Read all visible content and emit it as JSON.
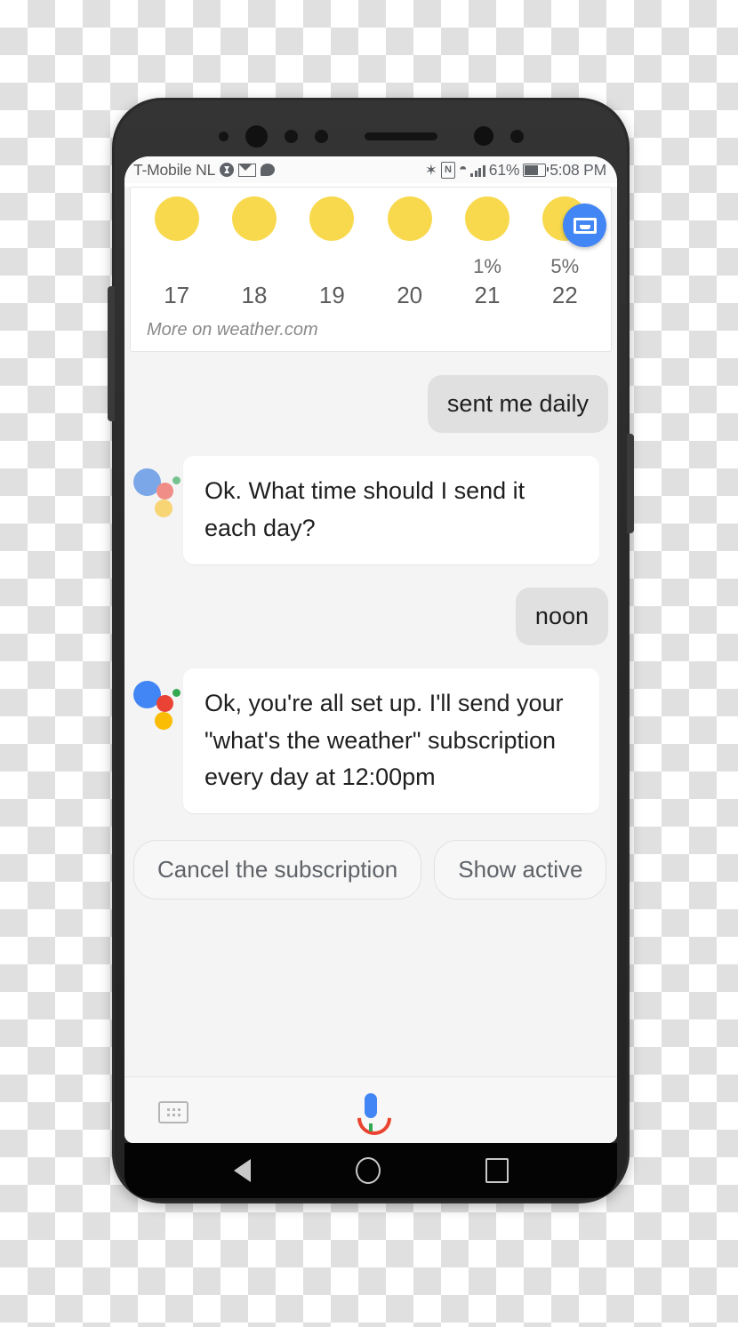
{
  "statusbar": {
    "carrier": "T-Mobile  NL",
    "battery_percent": "61%",
    "time": "5:08 PM",
    "icons_left": [
      "gear-badge-icon",
      "gmail-icon",
      "chat-bubble-icon"
    ],
    "icons_right": [
      "bluetooth-icon",
      "nfc-icon",
      "wifi-icon",
      "signal-icon",
      "battery-icon"
    ],
    "bluetooth_glyph": "✶",
    "nfc_glyph": "N",
    "wifi_glyph": "◠"
  },
  "weather_card": {
    "forecast": [
      {
        "icon": "sun-icon",
        "precip": "",
        "day": "17"
      },
      {
        "icon": "sun-icon",
        "precip": "",
        "day": "18"
      },
      {
        "icon": "sun-icon",
        "precip": "",
        "day": "19"
      },
      {
        "icon": "sun-icon",
        "precip": "",
        "day": "20"
      },
      {
        "icon": "sun-icon",
        "precip": "1%",
        "day": "21"
      },
      {
        "icon": "sun-icon",
        "precip": "5%",
        "day": "22"
      }
    ],
    "footer_link": "More on weather.com",
    "fab": {
      "name": "inbox-icon",
      "color": "#4285f4"
    }
  },
  "conversation": [
    {
      "role": "user",
      "text": "sent me daily"
    },
    {
      "role": "assistant",
      "text": "Ok. What time should I send it each day?"
    },
    {
      "role": "user",
      "text": "noon"
    },
    {
      "role": "assistant",
      "text": "Ok, you're all set up. I'll send your \"what's the weather\" subscription every day at 12:00pm"
    }
  ],
  "suggestion_chips": [
    {
      "label": "Cancel the subscription"
    },
    {
      "label": "Show active"
    }
  ],
  "input_bar": {
    "keyboard_icon": "keyboard-icon",
    "mic_icon": "google-mic-icon"
  },
  "navbar": {
    "back": "back-icon",
    "home": "home-icon",
    "recents": "recents-icon"
  },
  "colors": {
    "assistant_blue": "#4285f4",
    "assistant_red": "#ea4335",
    "assistant_yellow": "#fbbc04",
    "assistant_green": "#34a853",
    "assistant_blue_muted": "#7ba7e8",
    "assistant_red_muted": "#ef8d86",
    "assistant_yellow_muted": "#f7d474",
    "assistant_green_muted": "#76c28f",
    "sun_yellow": "#f8d94e",
    "user_bubble": "#e0e0e0",
    "chat_background": "#f4f4f4"
  }
}
